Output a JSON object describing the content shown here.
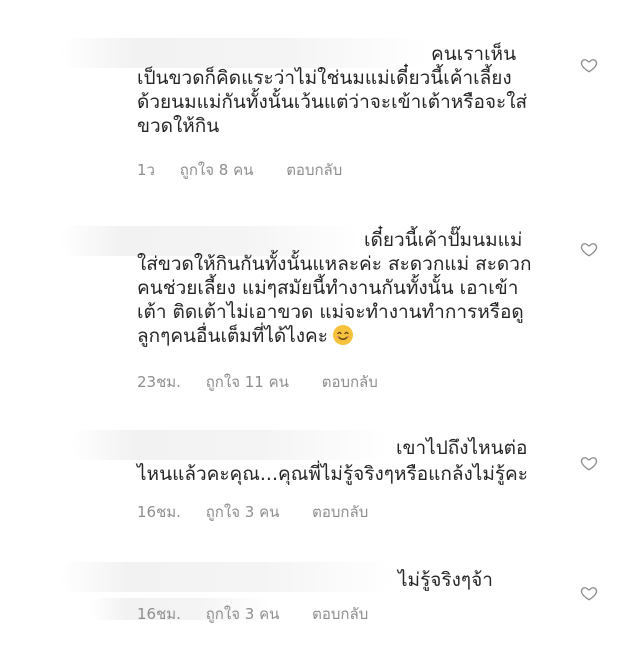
{
  "comments": [
    {
      "username": "คนเราเห็น",
      "text": "เป็นขวดก็คิดแระว่าไม่ใช่นมแม่เดี๋ยวนี้เค้าเลี้ยง\nด้วยนมแม่กันทั้งนั้นเว้นแต่ว่าจะเข้าเต้าหรือจะใส่\nขวดให้กิน",
      "time": "1ว",
      "likes": "ถูกใจ 8 คน",
      "reply": "ตอบกลับ",
      "emoji": ""
    },
    {
      "username": "เดี๋ยวนี้เค้าปั๊มนมแม่",
      "text": "ใส่ขวดให้กินกันทั้งนั้นแหละค่ะ สะดวกแม่ สะดวก\nคนช่วยเลี้ยง แม่ๆสมัยนี้ทำงานกันทั้งนั้น เอาเข้า\nเต้า ติดเต้าไม่เอาขวด แม่จะทำงานทำการหรือดู\nลูกๆคนอื่นเต็มที่ได้ไงคะ",
      "time": "23ชม.",
      "likes": "ถูกใจ 11 คน",
      "reply": "ตอบกลับ",
      "emoji": "smiling-face-emoji"
    },
    {
      "username": "เขาไปถึงไหนต่อ",
      "text": "ไหนแล้วคะคุณ...คุณพี่ไม่รู้จริงๆหรือแกล้งไม่รู้คะ",
      "time": "16ชม.",
      "likes": "ถูกใจ 3 คน",
      "reply": "ตอบกลับ",
      "emoji": ""
    },
    {
      "username": "ไม่รู้จริงๆจ้า",
      "text": "",
      "time": "16ชม.",
      "likes": "ถูกใจ 3 คน",
      "reply": "ตอบกลับ",
      "emoji": ""
    }
  ],
  "icons": {
    "like": "heart-outline-icon"
  },
  "colors": {
    "text": "#262626",
    "meta": "#8e8e8e",
    "emoji": "#f5c33b"
  }
}
